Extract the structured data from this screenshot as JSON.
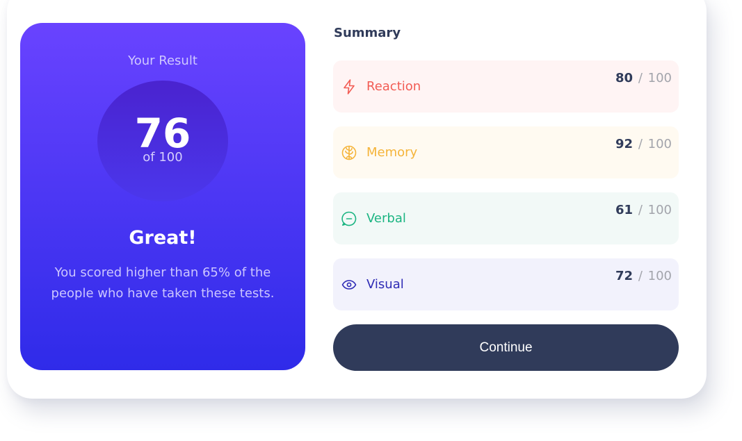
{
  "result": {
    "title": "Your Result",
    "score": "76",
    "of_label": "of 100",
    "verdict": "Great!",
    "message": "You scored higher than 65% of the people who have taken these tests."
  },
  "summary": {
    "title": "Summary",
    "items": [
      {
        "label": "Reaction",
        "score": "80",
        "max": "100",
        "icon": "lightning-icon",
        "color": "#f25c54",
        "bg": "#fff4f4"
      },
      {
        "label": "Memory",
        "score": "92",
        "max": "100",
        "icon": "brain-icon",
        "color": "#f5b43a",
        "bg": "#fffaf1"
      },
      {
        "label": "Verbal",
        "score": "61",
        "max": "100",
        "icon": "chat-icon",
        "color": "#1cb582",
        "bg": "#f2f9f7"
      },
      {
        "label": "Visual",
        "score": "72",
        "max": "100",
        "icon": "eye-icon",
        "color": "#2e2bb5",
        "bg": "#f2f2fc"
      }
    ],
    "slash": "/"
  },
  "continue_label": "Continue"
}
